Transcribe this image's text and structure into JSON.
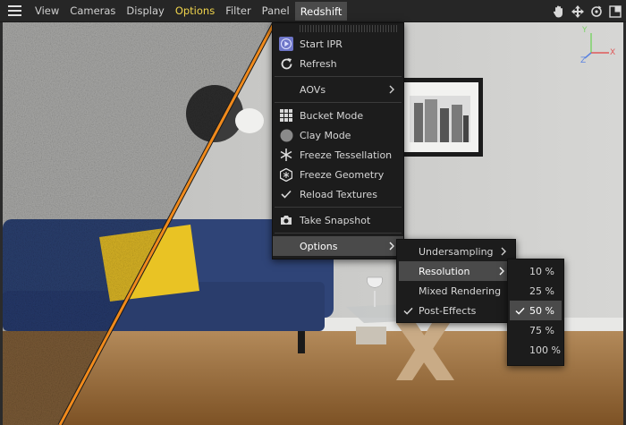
{
  "menubar": {
    "items": [
      {
        "label": "View",
        "name": "menu-view"
      },
      {
        "label": "Cameras",
        "name": "menu-cameras"
      },
      {
        "label": "Display",
        "name": "menu-display"
      },
      {
        "label": "Options",
        "name": "menu-options"
      },
      {
        "label": "Filter",
        "name": "menu-filter"
      },
      {
        "label": "Panel",
        "name": "menu-panel"
      },
      {
        "label": "Redshift",
        "name": "menu-redshift"
      }
    ],
    "right_icons": [
      "hand-icon",
      "move-icon",
      "rotate-icon",
      "maximize-icon"
    ]
  },
  "axis": {
    "y": "Y",
    "x": "X",
    "z": "Z"
  },
  "redshift_menu": {
    "start_ipr": "Start IPR",
    "refresh": "Refresh",
    "aovs": "AOVs",
    "bucket_mode": "Bucket Mode",
    "clay_mode": "Clay Mode",
    "freeze_tessellation": "Freeze Tessellation",
    "freeze_geometry": "Freeze Geometry",
    "reload_textures": "Reload Textures",
    "take_snapshot": "Take Snapshot",
    "options": "Options"
  },
  "options_menu": {
    "undersampling": "Undersampling",
    "resolution": "Resolution",
    "mixed_rendering": "Mixed Rendering",
    "post_effects": "Post-Effects"
  },
  "resolution_menu": {
    "items": [
      "10 %",
      "25 %",
      "50 %",
      "75 %",
      "100 %"
    ],
    "selected": "50 %"
  },
  "colors": {
    "menubar_bg": "#262626",
    "menu_bg": "#1c1c1c",
    "highlight": "#4a4a4a",
    "yellow_menu": "#f0d44c",
    "split_line": "#f08a1c",
    "sofa": "#2f4477",
    "pillow": "#e9c324"
  }
}
